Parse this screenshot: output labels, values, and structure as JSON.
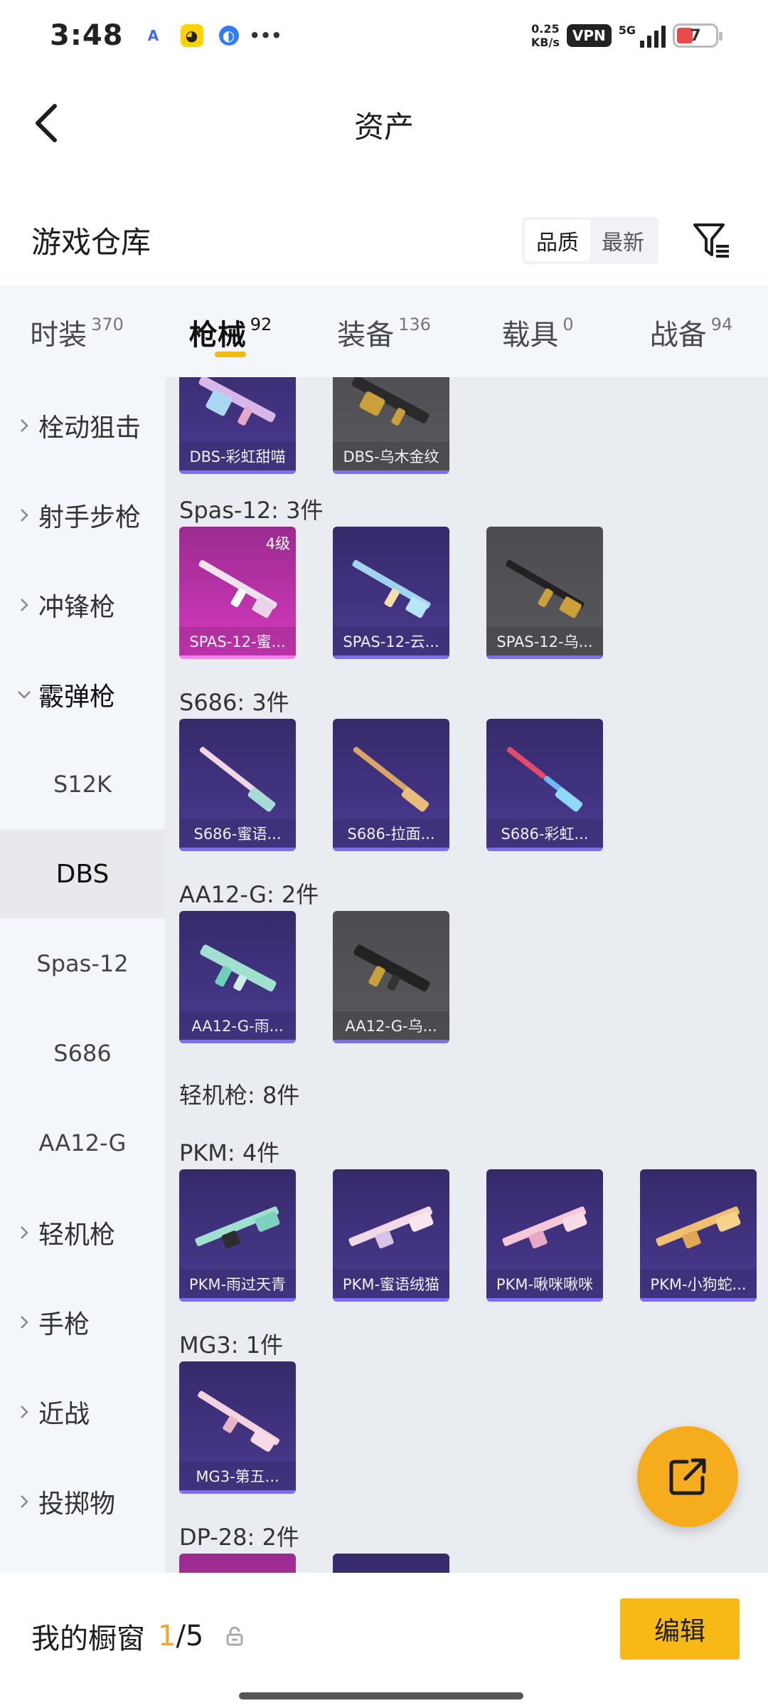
{
  "status_bar": {
    "time": "3:48",
    "net_speed_value": "0.25",
    "net_speed_unit": "KB/s",
    "vpn": "VPN",
    "network": "5G",
    "battery": "7"
  },
  "header": {
    "title": "资产",
    "back_icon": "chevron-left-icon"
  },
  "warehouse": {
    "title": "游戏仓库",
    "sort_options": [
      "品质",
      "最新"
    ],
    "active_sort": "品质",
    "filter_icon": "filter-icon"
  },
  "category_tabs": [
    {
      "label": "时装",
      "count": "370"
    },
    {
      "label": "枪械",
      "count": "92",
      "active": true
    },
    {
      "label": "装备",
      "count": "136"
    },
    {
      "label": "载具",
      "count": "0"
    },
    {
      "label": "战备",
      "count": "94"
    }
  ],
  "sidenav": [
    {
      "label": "栓动狙击",
      "type": "collapsed"
    },
    {
      "label": "射手步枪",
      "type": "collapsed"
    },
    {
      "label": "冲锋枪",
      "type": "collapsed"
    },
    {
      "label": "霰弹枪",
      "type": "expanded"
    },
    {
      "label": "S12K",
      "type": "sub"
    },
    {
      "label": "DBS",
      "type": "sub",
      "selected": true
    },
    {
      "label": "Spas-12",
      "type": "sub"
    },
    {
      "label": "S686",
      "type": "sub"
    },
    {
      "label": "AA12-G",
      "type": "sub"
    },
    {
      "label": "轻机枪",
      "type": "collapsed"
    },
    {
      "label": "手枪",
      "type": "collapsed"
    },
    {
      "label": "近战",
      "type": "collapsed"
    },
    {
      "label": "投掷物",
      "type": "collapsed"
    }
  ],
  "content": {
    "dbs_items": [
      {
        "name": "DBS-彩虹甜喵",
        "style": "purple"
      },
      {
        "name": "DBS-乌木金纹",
        "style": "gray"
      }
    ],
    "spas_title": "Spas-12: 3件",
    "spas_items": [
      {
        "name": "SPAS-12-蜜...",
        "style": "pink",
        "level": "4级"
      },
      {
        "name": "SPAS-12-云...",
        "style": "purple"
      },
      {
        "name": "SPAS-12-乌...",
        "style": "gray"
      }
    ],
    "s686_title": "S686: 3件",
    "s686_items": [
      {
        "name": "S686-蜜语...",
        "style": "purple"
      },
      {
        "name": "S686-拉面...",
        "style": "purple"
      },
      {
        "name": "S686-彩虹...",
        "style": "purple"
      }
    ],
    "aa12_title": "AA12-G: 2件",
    "aa12_items": [
      {
        "name": "AA12-G-雨...",
        "style": "purple"
      },
      {
        "name": "AA12-G-乌...",
        "style": "gray"
      }
    ],
    "lmg_title": "轻机枪: 8件",
    "pkm_title": "PKM: 4件",
    "pkm_items": [
      {
        "name": "PKM-雨过天青",
        "style": "purple"
      },
      {
        "name": "PKM-蜜语绒猫",
        "style": "purple"
      },
      {
        "name": "PKM-啾咪啾咪",
        "style": "purple"
      },
      {
        "name": "PKM-小狗蛇...",
        "style": "purple"
      }
    ],
    "mg3_title": "MG3: 1件",
    "mg3_items": [
      {
        "name": "MG3-第五...",
        "style": "purple"
      }
    ],
    "dp28_title": "DP-28: 2件"
  },
  "fab_icon": "share-external-icon",
  "footer": {
    "showcase_label": "我的橱窗",
    "showcase_current": "1",
    "showcase_total": "/5",
    "lock_icon": "lock-icon",
    "edit_label": "编辑"
  },
  "colors": {
    "accent": "#f7b916",
    "card_purple": "#4b3a92",
    "card_gray": "#58585d",
    "card_pink": "#d53ac1"
  }
}
